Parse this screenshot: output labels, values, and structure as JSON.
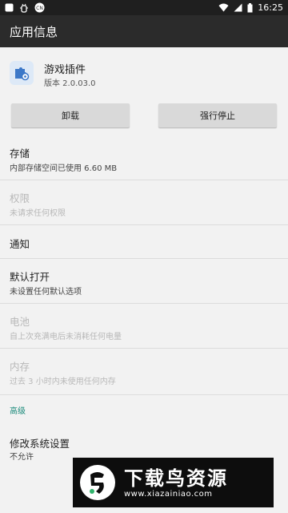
{
  "status_bar": {
    "time": "16:25"
  },
  "app_bar": {
    "title": "应用信息"
  },
  "app": {
    "name": "游戏插件",
    "version": "版本 2.0.03.0"
  },
  "buttons": {
    "uninstall": "卸载",
    "force_stop": "强行停止"
  },
  "items": [
    {
      "title": "存储",
      "subtitle": "内部存储空间已使用 6.60 MB",
      "enabled": true
    },
    {
      "title": "权限",
      "subtitle": "未请求任何权限",
      "enabled": false
    },
    {
      "title": "通知",
      "subtitle": "",
      "enabled": true
    },
    {
      "title": "默认打开",
      "subtitle": "未设置任何默认选项",
      "enabled": true
    },
    {
      "title": "电池",
      "subtitle": "自上次充满电后未消耗任何电量",
      "enabled": false
    },
    {
      "title": "内存",
      "subtitle": "过去 3 小时内未使用任何内存",
      "enabled": false
    }
  ],
  "advanced": {
    "header": "高级",
    "title": "修改系统设置",
    "subtitle": "不允许"
  },
  "watermark": {
    "title": "下载鸟资源",
    "url": "www.xiazainiao.com"
  },
  "colors": {
    "accent": "#1a8a7a",
    "app_bar": "#2b2b2b",
    "status_bar": "#1f1f1f"
  }
}
